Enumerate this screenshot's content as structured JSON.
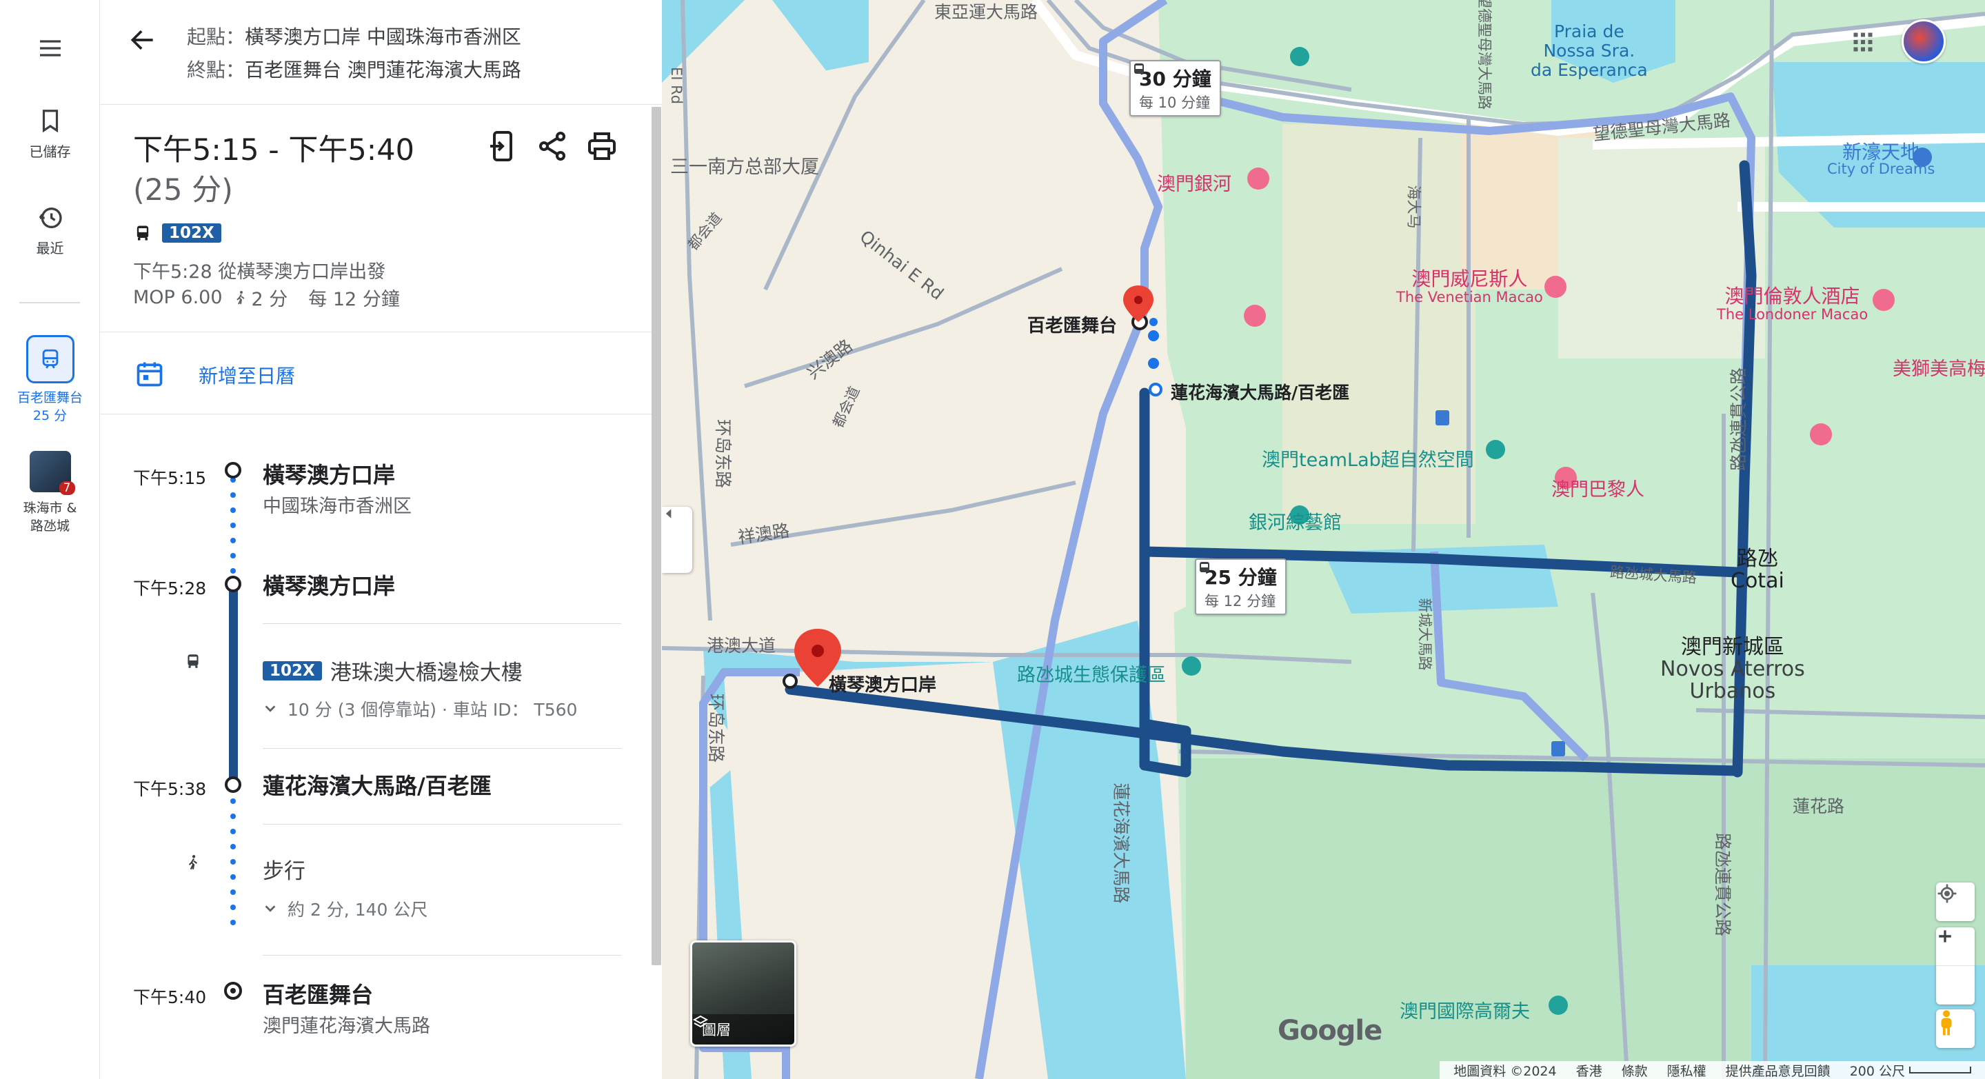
{
  "rail": {
    "saved_label": "已儲存",
    "recent_label": "最近",
    "active_trip_label_1": "百老匯舞台",
    "active_trip_label_2": "25 分",
    "area_label_1": "珠海市 &",
    "area_label_2": "路氹城",
    "area_badge": "7"
  },
  "header": {
    "origin_label": "起點：",
    "origin_value": "橫琴澳方口岸 中國珠海市香洲区",
    "dest_label": "終點：",
    "dest_value": "百老匯舞台 澳門蓮花海濱大馬路"
  },
  "summary": {
    "time_range": "下午5:15 - 下午5:40",
    "duration": "(25 分)",
    "route": "102X",
    "depart": "下午5:28 從橫琴澳方口岸出發",
    "fare": "MOP 6.00",
    "walk": "2 分",
    "frequency": "每 12 分鐘",
    "add_calendar": "新增至日曆"
  },
  "steps": {
    "s1_time": "下午5:15",
    "s1_name": "橫琴澳方口岸",
    "s1_sub": "中國珠海市香洲区",
    "s2_time": "下午5:28",
    "s2_name": "橫琴澳方口岸",
    "bus_route": "102X",
    "bus_headsign": "港珠澳大橋邊檢大樓",
    "bus_detail": "10 分 (3 個停靠站) · 車站 ID： T560",
    "s3_time": "下午5:38",
    "s3_name": "蓮花海濱大馬路/百老匯",
    "walk_label": "步行",
    "walk_detail": "約 2 分, 140 公尺",
    "s4_time": "下午5:40",
    "s4_name": "百老匯舞台",
    "s4_sub": "澳門蓮花海濱大馬路"
  },
  "map": {
    "callout_top_main": "30 分鐘",
    "callout_top_sub": "每 10 分鐘",
    "callout_mid_main": "25 分鐘",
    "callout_mid_sub": "每 12 分鐘",
    "dest_marker": "百老匯舞台",
    "stop_label": "蓮花海濱大馬路/百老匯",
    "origin_marker": "橫琴澳方口岸",
    "labels": {
      "east_asia_road": "東亞運大馬路",
      "praia_1": "Praia de",
      "praia_2": "Nossa Sra.",
      "praia_3": "da Esperanca",
      "bay_road": "望德聖母灣大馬路",
      "xinhao_cn": "新濠天地",
      "xinhao_en": "City of Dreams",
      "sanyi": "三一南方总部大厦",
      "galaxy": "澳門銀河",
      "qinhai": "Qinhai E Rd",
      "venetian_cn": "澳門威尼斯人",
      "venetian_en": "The Venetian Macao",
      "londoner_cn": "澳門倫敦人酒店",
      "londoner_en": "The Londoner Macao",
      "mgm": "美獅美高梅",
      "xingao": "兴澳路",
      "teamlab": "澳門teamLab超自然空間",
      "paris": "澳門巴黎人",
      "galaxy_arena": "銀河綜藝館",
      "cotai_cn": "路氹",
      "cotai_en": "Cotai",
      "xiangao": "祥澳路",
      "gangao": "港澳大道",
      "huandao_a": "环岛东路",
      "huandao_b": "环岛东路",
      "eco_reserve": "路氹城生態保護區",
      "novos_cn": "澳門新城區",
      "novos_en_1": "Novos Aterros",
      "novos_en_2": "Urbanos",
      "lotus_road": "蓮花路",
      "lotus_binhai": "蓮花海濱大馬路",
      "golf": "澳門國際高爾夫",
      "cotai_ave": "路氹連貫公路",
      "cotai_ave_2": "路氹連貫公路",
      "cotai_flower": "路氹城大馬路",
      "xincheng": "新城大馬路",
      "weijing": "望德聖母灣大馬路",
      "dusheng": "都会道",
      "dusheng2": "都会道",
      "daowu": "海大马",
      "road_e": "EI Rd",
      "huan": "环岛东路"
    },
    "layers_label": "圖層",
    "footer": {
      "data": "地圖資料 ©2024",
      "region": "香港",
      "terms": "條款",
      "privacy": "隱私權",
      "feedback": "提供產品意見回饋",
      "scale": "200 公尺"
    },
    "logo": "Google"
  },
  "colors": {
    "route_dark": "#1d4e89",
    "route_light": "#9fb4ea",
    "water": "#90daee",
    "green": "#c8ebcd",
    "accent": "#1a73e8"
  }
}
